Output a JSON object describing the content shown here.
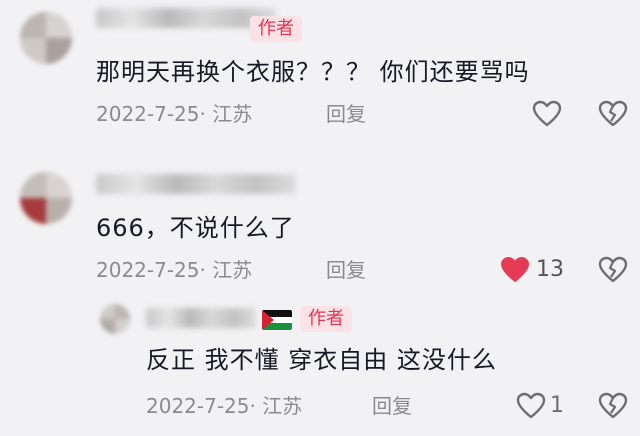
{
  "colors": {
    "background": "#f2f2f4",
    "text": "#161823",
    "meta": "#8a8b91",
    "author_tag_bg": "#fbe2e6",
    "author_tag_text": "#e8344f",
    "liked": "#e53b56"
  },
  "comments": [
    {
      "author_tag": "作者",
      "text": "那明天再换个衣服？？？ 你们还要骂吗",
      "date": "2022-7-25",
      "region": "· 江苏",
      "reply_label": "回复",
      "likes": "",
      "liked": false,
      "icons": [
        "heart-outline-icon",
        "broken-heart-icon"
      ]
    },
    {
      "text": "666，不说什么了",
      "date": "2022-7-25",
      "region": "· 江苏",
      "reply_label": "回复",
      "likes": "13",
      "liked": true,
      "icons": [
        "heart-filled-icon",
        "broken-heart-icon"
      ]
    },
    {
      "author_tag": "作者",
      "flag_icon": "palestine-flag-icon",
      "text": "反正 我不懂 穿衣自由 这没什么",
      "date": "2022-7-25",
      "region": "· 江苏",
      "reply_label": "回复",
      "likes": "1",
      "liked": false,
      "icons": [
        "heart-outline-icon",
        "broken-heart-icon"
      ]
    }
  ]
}
